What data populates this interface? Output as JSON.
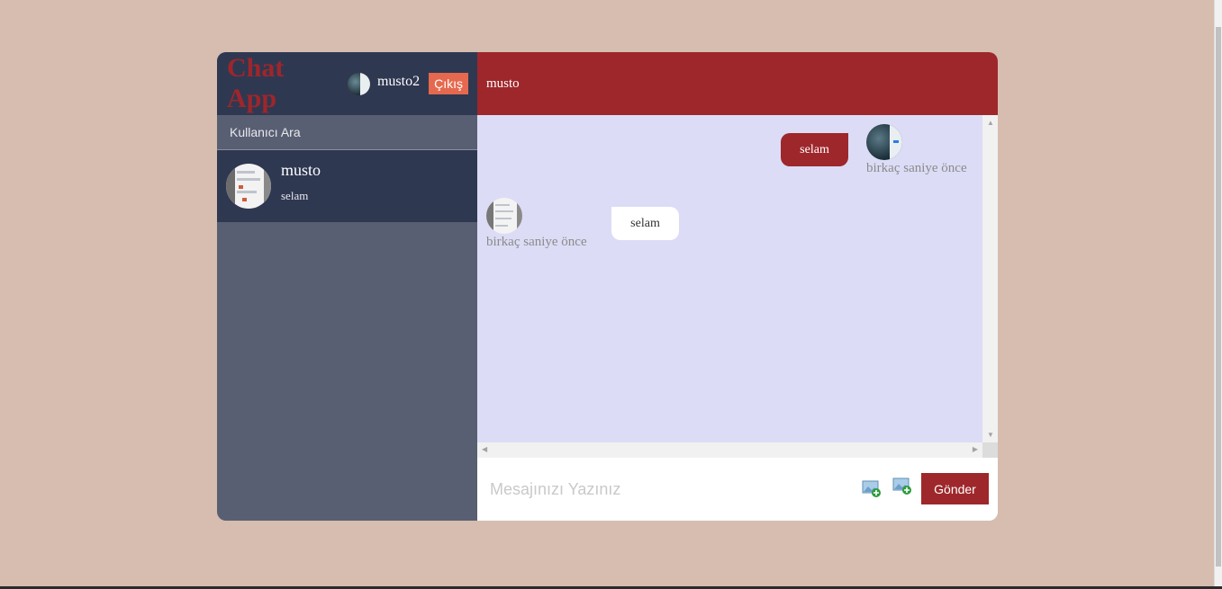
{
  "navbar": {
    "logo": "Chat App",
    "username": "musto2",
    "logout_label": "Çıkış"
  },
  "search": {
    "placeholder": "Kullanıcı Ara"
  },
  "chats": [
    {
      "name": "musto",
      "last_message": "selam"
    }
  ],
  "chat_header": {
    "name": "musto"
  },
  "messages": [
    {
      "text": "selam",
      "time": "birkaç saniye önce",
      "owner": true
    },
    {
      "text": "selam",
      "time": "birkaç saniye önce",
      "owner": false
    }
  ],
  "input": {
    "placeholder": "Mesajınızı Yazınız",
    "send_label": "Gönder"
  },
  "colors": {
    "page_background": "#d6bdb0",
    "sidebar": "#595f72",
    "navbar": "#2f3851",
    "accent": "#9e272b",
    "logout": "#e5694f",
    "messages_background": "#dcdcf6"
  }
}
